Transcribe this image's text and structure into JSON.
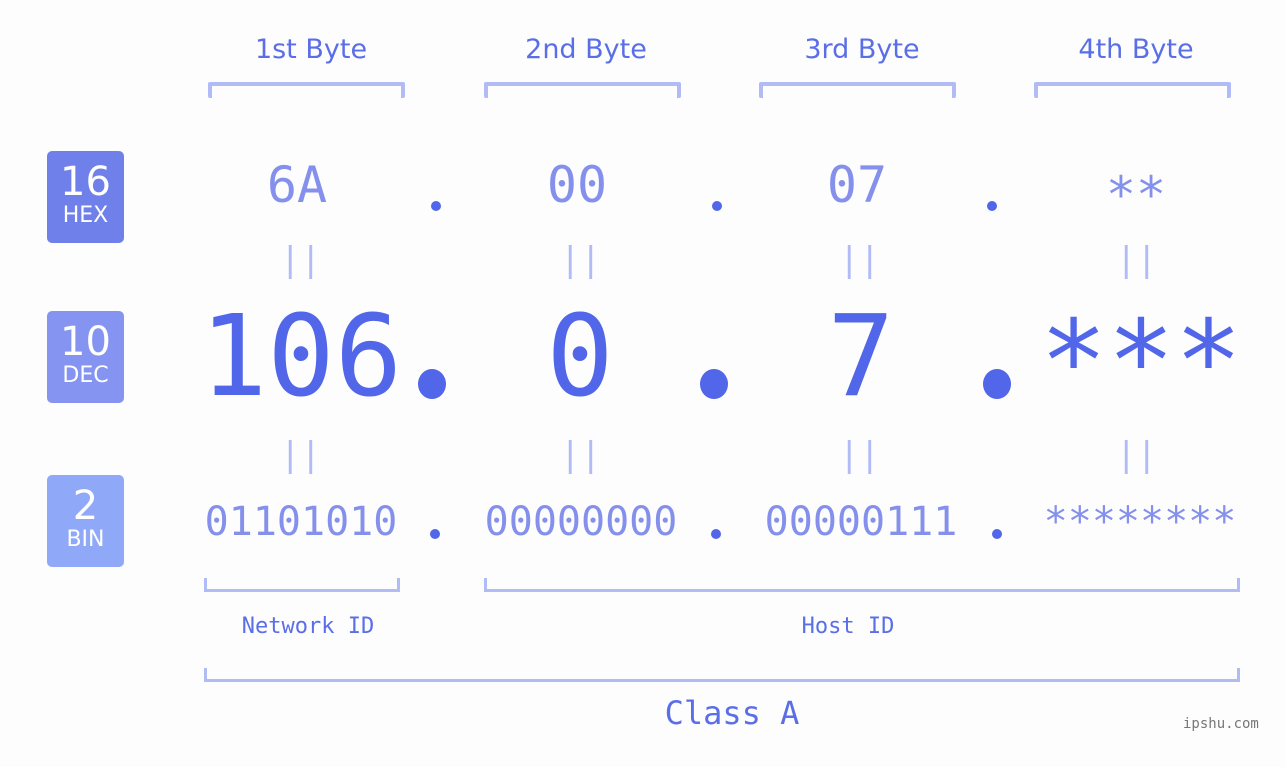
{
  "headers": [
    "1st Byte",
    "2nd Byte",
    "3rd Byte",
    "4th Byte"
  ],
  "badges": [
    {
      "num": "16",
      "label": "HEX",
      "color": "#7080eb"
    },
    {
      "num": "10",
      "label": "DEC",
      "color": "#8594f0"
    },
    {
      "num": "2",
      "label": "BIN",
      "color": "#8fa8f8"
    }
  ],
  "hex": [
    "6A",
    "00",
    "07",
    "**"
  ],
  "dec": [
    "106",
    "0",
    "7",
    "***"
  ],
  "bin": [
    "01101010",
    "00000000",
    "00000111",
    "********"
  ],
  "equals_glyph": "||",
  "network_label": "Network ID",
  "host_label": "Host ID",
  "class_label": "Class A",
  "watermark": "ipshu.com",
  "colors": {
    "primary": "#5166e8",
    "light": "#8490ec",
    "bracket": "#b1bbf5"
  }
}
